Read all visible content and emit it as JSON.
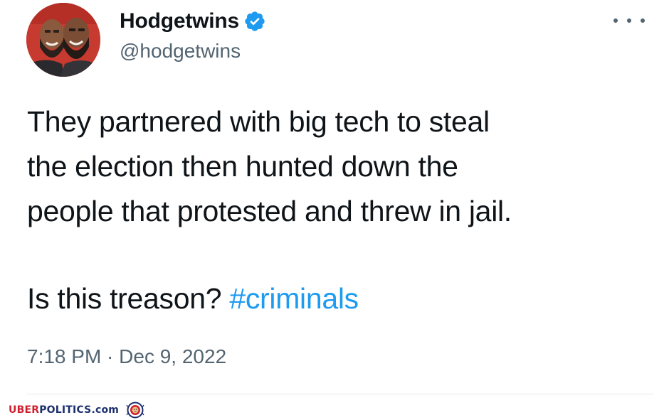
{
  "tweet": {
    "display_name": "Hodgetwins",
    "handle": "@hodgetwins",
    "verified": true,
    "text_lines": [
      "They partnered with big tech to steal",
      "the election then hunted down the",
      "people that protested and threw in jail."
    ],
    "question": "Is this treason? ",
    "hashtag": "#criminals",
    "timestamp": "7:18 PM · Dec 9, 2022"
  },
  "watermark": {
    "part1": "UBER",
    "part2": "POLITICS.com"
  },
  "colors": {
    "hashtag": "#1d9bf0",
    "verified_badge": "#1d9bf0",
    "text": "#0f1419",
    "muted": "#536471",
    "watermark_red": "#d02030",
    "watermark_blue": "#1b2f6e"
  },
  "icons": {
    "verified": "verified-badge-icon",
    "more": "more-options-icon",
    "seal": "lion-seal-icon"
  }
}
